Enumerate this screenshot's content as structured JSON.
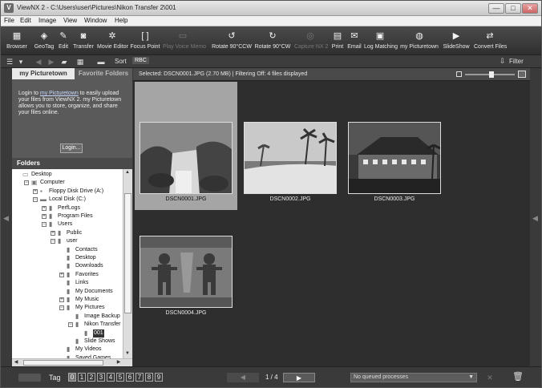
{
  "window": {
    "title": "ViewNX 2 - C:\\Users\\user\\Pictures\\Nikon Transfer 2\\001",
    "controls": {
      "minimize": "—",
      "maximize": "□",
      "close": "✕"
    }
  },
  "menu": [
    "File",
    "Edit",
    "Image",
    "View",
    "Window",
    "Help"
  ],
  "toolbar": [
    {
      "label": "Browser",
      "icon": "browser-icon",
      "glyph": "▦",
      "enabled": true
    },
    {
      "label": "GeoTag",
      "icon": "geotag-icon",
      "glyph": "◈",
      "enabled": true
    },
    {
      "label": "Edit",
      "icon": "edit-icon",
      "glyph": "✎",
      "enabled": true
    },
    {
      "label": "Transfer",
      "icon": "transfer-icon",
      "glyph": "◙",
      "enabled": true
    },
    {
      "label": "Movie Editor",
      "icon": "movie-editor-icon",
      "glyph": "✲",
      "enabled": true
    },
    {
      "label": "Focus Point",
      "icon": "focus-point-icon",
      "glyph": "[ ]",
      "enabled": true
    },
    {
      "label": "Play Voice Memo",
      "icon": "voice-memo-icon",
      "glyph": "▭",
      "enabled": false
    },
    {
      "label": "Rotate 90°CCW",
      "icon": "rotate-ccw-icon",
      "glyph": "↺",
      "enabled": true
    },
    {
      "label": "Rotate 90°CW",
      "icon": "rotate-cw-icon",
      "glyph": "↻",
      "enabled": true
    },
    {
      "label": "Capture NX 2",
      "icon": "capture-nx-icon",
      "glyph": "◎",
      "enabled": false
    },
    {
      "label": "Print",
      "icon": "print-icon",
      "glyph": "▤",
      "enabled": true
    },
    {
      "label": "Email",
      "icon": "email-icon",
      "glyph": "✉",
      "enabled": true
    },
    {
      "label": "Log Matching",
      "icon": "log-matching-icon",
      "glyph": "▣",
      "enabled": true
    },
    {
      "label": "my Picturetown",
      "icon": "picturetown-icon",
      "glyph": "◍",
      "enabled": true
    },
    {
      "label": "SlideShow",
      "icon": "slideshow-icon",
      "glyph": "▶",
      "enabled": true
    },
    {
      "label": "Convert Files",
      "icon": "convert-files-icon",
      "glyph": "⇄",
      "enabled": true
    }
  ],
  "subbar": {
    "sort_label": "Sort",
    "sort_value": "RBC",
    "filter_label": "Filter"
  },
  "left_panel": {
    "tabs": [
      "my Picturetown",
      "Favorite Folders"
    ],
    "picturetown": {
      "text_before": "Login to ",
      "link": "my Picturetown",
      "text_after": " to easily upload your files from ViewNX 2. my Picturetown allows you to store, organize, and share your files online.",
      "login_button": "Login..."
    },
    "folders_header": "Folders",
    "tree": [
      {
        "label": "Desktop",
        "depth": 0,
        "expander": "",
        "icon": "desktop-icon"
      },
      {
        "label": "Computer",
        "depth": 1,
        "expander": "−",
        "icon": "computer-icon"
      },
      {
        "label": "Floppy Disk Drive (A:)",
        "depth": 2,
        "expander": "+",
        "icon": "floppy-icon"
      },
      {
        "label": "Local Disk (C:)",
        "depth": 2,
        "expander": "−",
        "icon": "disk-icon"
      },
      {
        "label": "PerfLogs",
        "depth": 3,
        "expander": "+",
        "icon": "folder-icon"
      },
      {
        "label": "Program Files",
        "depth": 3,
        "expander": "+",
        "icon": "folder-icon"
      },
      {
        "label": "Users",
        "depth": 3,
        "expander": "−",
        "icon": "folder-icon"
      },
      {
        "label": "Public",
        "depth": 4,
        "expander": "+",
        "icon": "folder-icon"
      },
      {
        "label": "user",
        "depth": 4,
        "expander": "−",
        "icon": "folder-icon"
      },
      {
        "label": "Contacts",
        "depth": 5,
        "expander": "",
        "icon": "folder-icon"
      },
      {
        "label": "Desktop",
        "depth": 5,
        "expander": "",
        "icon": "folder-icon"
      },
      {
        "label": "Downloads",
        "depth": 5,
        "expander": "",
        "icon": "folder-icon"
      },
      {
        "label": "Favorites",
        "depth": 5,
        "expander": "+",
        "icon": "folder-icon"
      },
      {
        "label": "Links",
        "depth": 5,
        "expander": "",
        "icon": "folder-icon"
      },
      {
        "label": "My Documents",
        "depth": 5,
        "expander": "",
        "icon": "folder-icon"
      },
      {
        "label": "My Music",
        "depth": 5,
        "expander": "+",
        "icon": "folder-icon"
      },
      {
        "label": "My Pictures",
        "depth": 5,
        "expander": "−",
        "icon": "folder-icon"
      },
      {
        "label": "Image Backup",
        "depth": 6,
        "expander": "",
        "icon": "folder-icon"
      },
      {
        "label": "Nikon Transfer",
        "depth": 6,
        "expander": "−",
        "icon": "folder-icon"
      },
      {
        "label": "001",
        "depth": 7,
        "expander": "",
        "icon": "folder-icon",
        "selected": true
      },
      {
        "label": "Slide Shows",
        "depth": 6,
        "expander": "",
        "icon": "folder-icon"
      },
      {
        "label": "My Videos",
        "depth": 5,
        "expander": "",
        "icon": "folder-icon"
      },
      {
        "label": "Saved Games",
        "depth": 5,
        "expander": "",
        "icon": "folder-icon"
      }
    ]
  },
  "browser": {
    "status": "Selected: DSCN0001.JPG (2.70 MB) | Filtering Off: 4 files displayed",
    "thumbnails": [
      {
        "caption": "DSCN0001.JPG",
        "scene": "waterfall",
        "selected": true
      },
      {
        "caption": "DSCN0002.JPG",
        "scene": "beach",
        "selected": false
      },
      {
        "caption": "DSCN0003.JPG",
        "scene": "building-night",
        "selected": false
      },
      {
        "caption": "DSCN0004.JPG",
        "scene": "carving",
        "selected": false
      }
    ]
  },
  "bottombar": {
    "tag_label": "Tag",
    "tags": [
      "0",
      "1",
      "2",
      "3",
      "4",
      "5",
      "6",
      "7",
      "8",
      "9"
    ],
    "prev": "◀",
    "page_indicator": "1 / 4",
    "next": "▶",
    "queue": "No queued processes",
    "queue_cancel": "✕",
    "trash": "🗑"
  }
}
